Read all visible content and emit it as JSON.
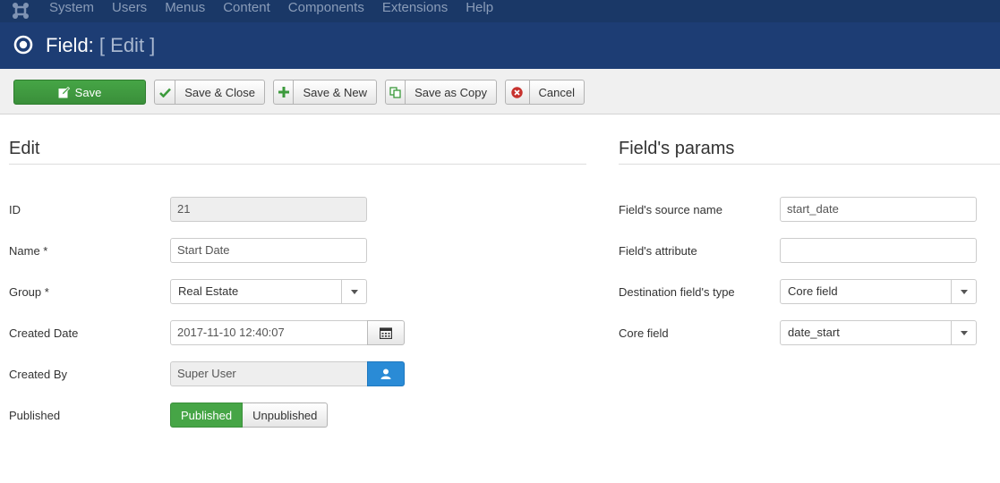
{
  "topnav": {
    "items": [
      "System",
      "Users",
      "Menus",
      "Content",
      "Components",
      "Extensions",
      "Help"
    ]
  },
  "title": {
    "main": "Field:",
    "sub": "[ Edit ]"
  },
  "toolbar": {
    "save": "Save",
    "save_close": "Save & Close",
    "save_new": "Save & New",
    "save_copy": "Save as Copy",
    "cancel": "Cancel"
  },
  "edit": {
    "heading": "Edit",
    "id_label": "ID",
    "id_value": "21",
    "name_label": "Name *",
    "name_value": "Start Date",
    "group_label": "Group *",
    "group_value": "Real Estate",
    "created_date_label": "Created Date",
    "created_date_value": "2017-11-10 12:40:07",
    "created_by_label": "Created By",
    "created_by_value": "Super User",
    "published_label": "Published",
    "published_on": "Published",
    "published_off": "Unpublished"
  },
  "params": {
    "heading": "Field's params",
    "source_label": "Field's source name",
    "source_value": "start_date",
    "attribute_label": "Field's attribute",
    "attribute_value": "",
    "dest_type_label": "Destination field's type",
    "dest_type_value": "Core field",
    "core_field_label": "Core field",
    "core_field_value": "date_start"
  },
  "colors": {
    "topnav": "#1a3867",
    "titlebar": "#1d3d74",
    "save_green": "#46a546",
    "user_blue": "#2a8bd6"
  }
}
